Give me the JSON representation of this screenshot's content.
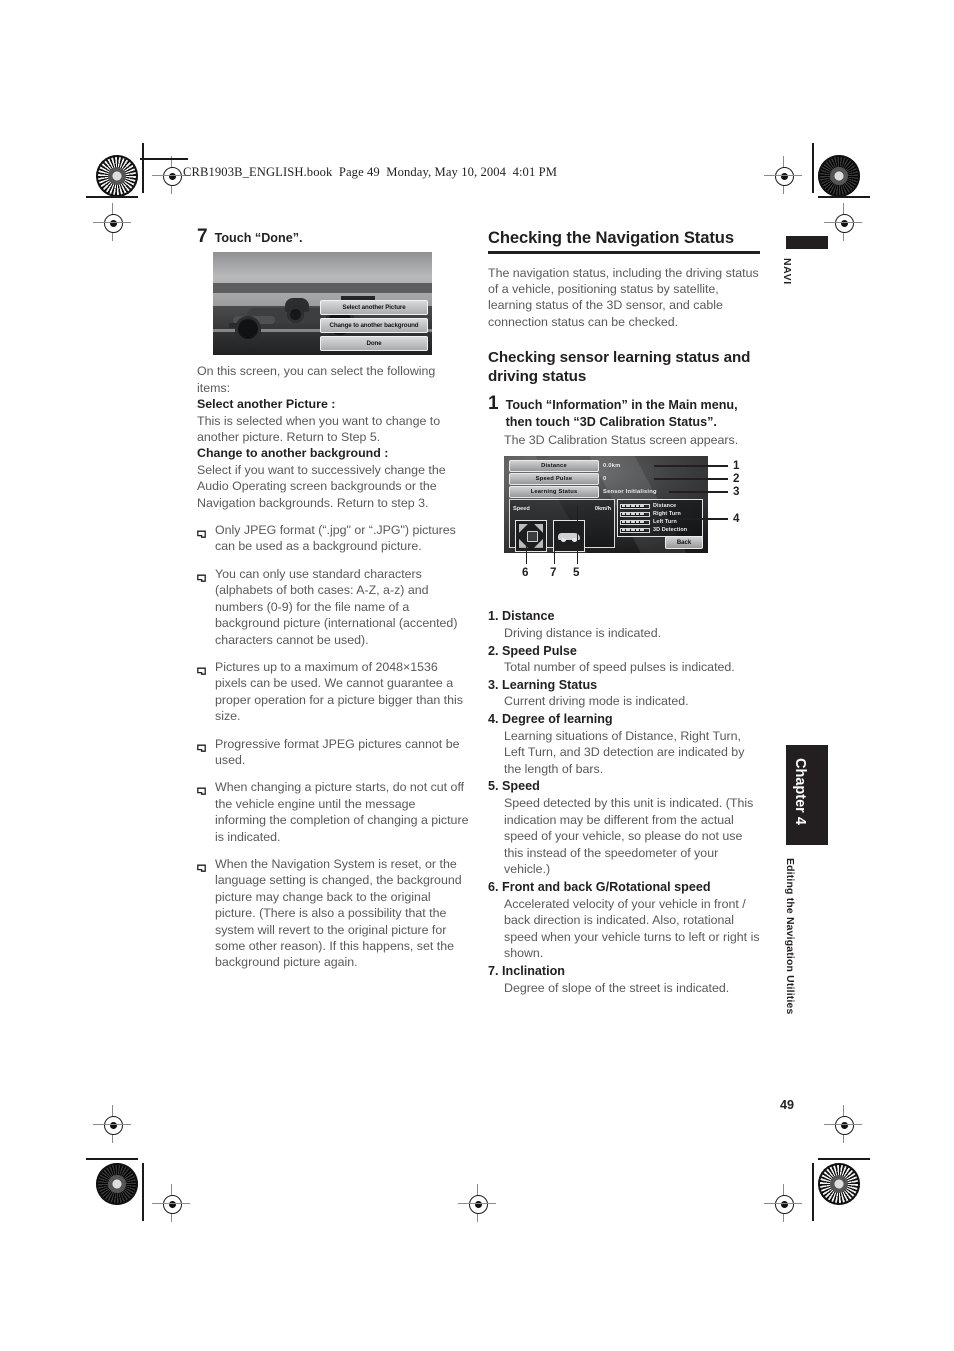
{
  "header": {
    "file_line": "CRB1903B_ENGLISH.book  Page 49  Monday, May 10, 2004  4:01 PM"
  },
  "page_number": "49",
  "left_column": {
    "step": {
      "number": "7",
      "text": "Touch “Done”."
    },
    "screenshot": {
      "buttons": [
        "Select another Picture",
        "Change to another background",
        "Done"
      ]
    },
    "intro": "On this screen, you can select the following items:",
    "options": [
      {
        "title": "Select another Picture :",
        "body": "This is selected when you want to change to another picture. Return to Step 5."
      },
      {
        "title": "Change to another background :",
        "body": "Select if you want to successively change the Audio Operating screen backgrounds or the Navigation backgrounds. Return to step 3."
      }
    ],
    "notes": [
      "Only JPEG format (“.jpg\" or “.JPG\") pictures can be used as a background picture.",
      "You can only use standard characters (alphabets of both cases: A-Z, a-z) and numbers (0-9) for the file name of a background picture (international (accented) characters cannot be used).",
      "Pictures up to a maximum of 2048×1536 pixels can be used. We cannot guarantee a proper operation for a picture bigger than this size.",
      "Progressive format JPEG pictures cannot be used.",
      "When changing a picture starts, do not cut off the vehicle engine until the message informing the completion of changing a picture is indicated.",
      "When the Navigation System is reset, or the language setting is changed, the background picture may change back to the original picture. (There is also a possibility that the system will revert to the original picture for some other reason). If this happens, set the background picture again."
    ]
  },
  "right_column": {
    "heading": "Checking the Navigation Status",
    "intro": "The navigation status, including the driving status of a vehicle, positioning status by satellite, learning status of the 3D sensor, and cable connection status can be checked.",
    "subheading": "Checking sensor learning status and driving status",
    "step": {
      "number": "1",
      "text": "Touch “Information” in the Main menu, then touch “3D Calibration Status”.",
      "note": "The 3D Calibration Status screen appears."
    },
    "calibration_screen": {
      "rows": [
        {
          "label": "Distance",
          "value": "0.0km"
        },
        {
          "label": "Speed Pulse",
          "value": "0"
        },
        {
          "label": "Learning Status",
          "value": "Sensor Initialising"
        }
      ],
      "speed_panel": {
        "label": "Speed",
        "value": "0km/h"
      },
      "bars": [
        {
          "label": "Distance",
          "filled": 5
        },
        {
          "label": "Right Turn",
          "filled": 5
        },
        {
          "label": "Left Turn",
          "filled": 5
        },
        {
          "label": "3D Detection",
          "filled": 5
        }
      ],
      "back_button": "Back",
      "callouts_right": [
        "1",
        "2",
        "3",
        "4"
      ],
      "callouts_bottom": [
        "6",
        "7",
        "5"
      ]
    },
    "items": [
      {
        "num": "1.",
        "title": "Distance",
        "desc": "Driving distance is indicated."
      },
      {
        "num": "2.",
        "title": "Speed Pulse",
        "desc": "Total number of speed pulses is indicated."
      },
      {
        "num": "3.",
        "title": "Learning Status",
        "desc": "Current driving mode is indicated."
      },
      {
        "num": "4.",
        "title": "Degree of learning",
        "desc": "Learning situations of Distance, Right Turn, Left Turn, and 3D detection are indicated by the length of bars."
      },
      {
        "num": "5.",
        "title": "Speed",
        "desc": "Speed detected by this unit is indicated. (This indication may be different from the actual speed of your vehicle, so please do not use this instead of the speedometer of your vehicle.)"
      },
      {
        "num": "6.",
        "title": "Front and back G/Rotational speed",
        "desc": "Accelerated velocity of your vehicle in front / back direction is indicated. Also, rotational speed when your vehicle turns to left or right is shown."
      },
      {
        "num": "7.",
        "title": "Inclination",
        "desc": "Degree of slope of the street is indicated."
      }
    ]
  },
  "side_tabs": {
    "top_label": "NAVI",
    "chapter_label": "Chapter 4",
    "chapter_subtitle": "Editing the Navigation Utilities"
  }
}
